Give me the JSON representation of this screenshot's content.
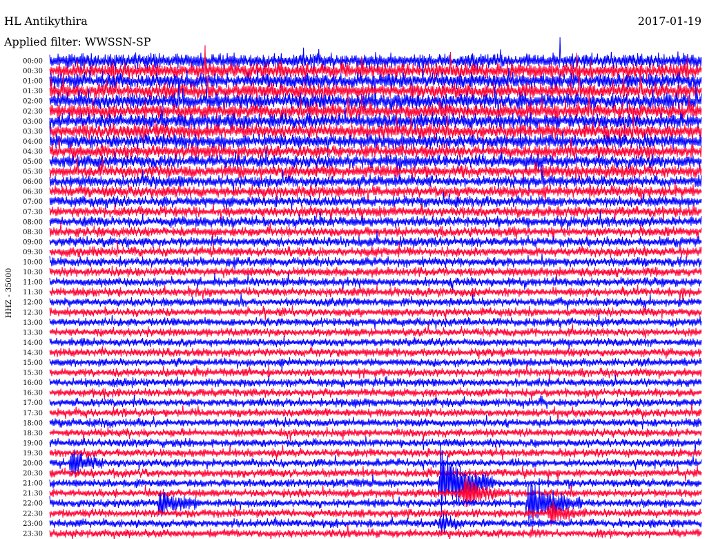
{
  "station": "HL Antikythira",
  "date": "2017-01-19",
  "filter_label": "Applied filter: WWSSN-SP",
  "channel_label": "HHZ - 35000",
  "colors": {
    "trace_a": "#0000ff",
    "trace_b": "#ff0033",
    "background": "#ffffff",
    "text": "#000000"
  },
  "chart_data": {
    "type": "line",
    "title": "HL Antikythira",
    "date": "2017-01-19",
    "ylabel": "HHZ - 35000",
    "xlabel": "",
    "trace_colors": [
      "#0000ff",
      "#ff0033"
    ],
    "rows": [
      {
        "label": "00:00",
        "noise": 1.0
      },
      {
        "label": "00:30",
        "noise": 1.0
      },
      {
        "label": "01:00",
        "noise": 1.0
      },
      {
        "label": "01:30",
        "noise": 1.0
      },
      {
        "label": "02:00",
        "noise": 1.0
      },
      {
        "label": "02:30",
        "noise": 1.0
      },
      {
        "label": "03:00",
        "noise": 1.0
      },
      {
        "label": "03:30",
        "noise": 0.95
      },
      {
        "label": "04:00",
        "noise": 0.9
      },
      {
        "label": "04:30",
        "noise": 0.85
      },
      {
        "label": "05:00",
        "noise": 0.8
      },
      {
        "label": "05:30",
        "noise": 0.75
      },
      {
        "label": "06:00",
        "noise": 0.7
      },
      {
        "label": "06:30",
        "noise": 0.65
      },
      {
        "label": "07:00",
        "noise": 0.6
      },
      {
        "label": "07:30",
        "noise": 0.58
      },
      {
        "label": "08:00",
        "noise": 0.55
      },
      {
        "label": "08:30",
        "noise": 0.52
      },
      {
        "label": "09:00",
        "noise": 0.5
      },
      {
        "label": "09:30",
        "noise": 0.48
      },
      {
        "label": "10:00",
        "noise": 0.46
      },
      {
        "label": "10:30",
        "noise": 0.44
      },
      {
        "label": "11:00",
        "noise": 0.42
      },
      {
        "label": "11:30",
        "noise": 0.4
      },
      {
        "label": "12:00",
        "noise": 0.4
      },
      {
        "label": "12:30",
        "noise": 0.38
      },
      {
        "label": "13:00",
        "noise": 0.38
      },
      {
        "label": "13:30",
        "noise": 0.36
      },
      {
        "label": "14:00",
        "noise": 0.36
      },
      {
        "label": "14:30",
        "noise": 0.36
      },
      {
        "label": "15:00",
        "noise": 0.35
      },
      {
        "label": "15:30",
        "noise": 0.35
      },
      {
        "label": "16:00",
        "noise": 0.35
      },
      {
        "label": "16:30",
        "noise": 0.35
      },
      {
        "label": "17:00",
        "noise": 0.35
      },
      {
        "label": "17:30",
        "noise": 0.35
      },
      {
        "label": "18:00",
        "noise": 0.35
      },
      {
        "label": "18:30",
        "noise": 0.35
      },
      {
        "label": "19:00",
        "noise": 0.35
      },
      {
        "label": "19:30",
        "noise": 0.35
      },
      {
        "label": "20:00",
        "noise": 0.35
      },
      {
        "label": "20:30",
        "noise": 0.35
      },
      {
        "label": "21:00",
        "noise": 0.35
      },
      {
        "label": "21:30",
        "noise": 0.35
      },
      {
        "label": "22:00",
        "noise": 0.35
      },
      {
        "label": "22:30",
        "noise": 0.35
      },
      {
        "label": "23:00",
        "noise": 0.35
      },
      {
        "label": "23:30",
        "noise": 0.35
      }
    ],
    "events": [
      {
        "row": 40,
        "minute": 1,
        "amplitude": 1.4,
        "duration_min": 1.5
      },
      {
        "row": 42,
        "minute": 18,
        "amplitude": 3.2,
        "duration_min": 2.5
      },
      {
        "row": 43,
        "minute": 19,
        "amplitude": 1.6,
        "duration_min": 2
      },
      {
        "row": 44,
        "minute": 5,
        "amplitude": 1.2,
        "duration_min": 2
      },
      {
        "row": 44,
        "minute": 22,
        "amplitude": 2.2,
        "duration_min": 2.5
      },
      {
        "row": 45,
        "minute": 23,
        "amplitude": 1.2,
        "duration_min": 1.5
      },
      {
        "row": 46,
        "minute": 18,
        "amplitude": 1.0,
        "duration_min": 1
      }
    ]
  }
}
